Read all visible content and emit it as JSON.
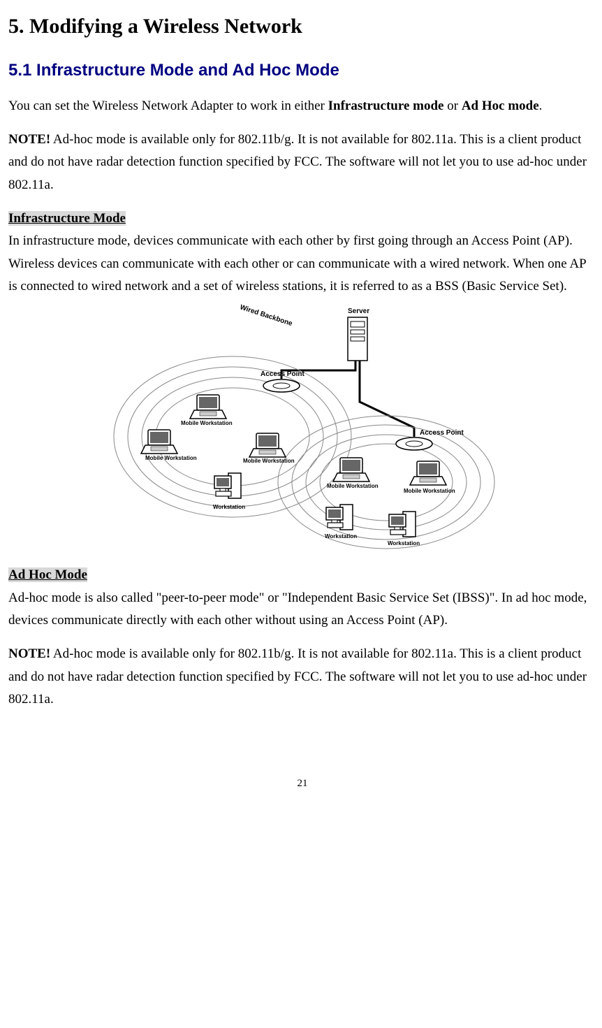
{
  "heading_main": "5. Modifying a Wireless Network",
  "heading_sub": "5.1 Infrastructure Mode and Ad Hoc Mode",
  "intro": {
    "t1": "You can set the Wireless Network Adapter to work in either ",
    "b1": "Infrastructure mode",
    "t2": " or ",
    "b2": "Ad Hoc mode",
    "t3": "."
  },
  "note1": {
    "label": "NOTE!",
    "text": " Ad-hoc mode is available only for 802.11b/g.    It is not available for 802.11a. This is a client product and do not have radar detection function specified by FCC. The software will not let you to use ad-hoc under 802.11a."
  },
  "infra": {
    "title": "Infrastructure Mode",
    "text": "In infrastructure mode, devices communicate with each other by first going through an Access Point (AP).    Wireless devices can communicate with each other or can communicate with a wired network.    When one AP is connected to wired network and a set of wireless stations, it is referred to as a BSS (Basic Service Set)."
  },
  "diagram": {
    "wired_backbone": "Wired Backbone",
    "server": "Server",
    "access_point": "Access Point",
    "mobile_workstation": "Mobile Workstation",
    "workstation": "Workstation"
  },
  "adhoc": {
    "title": "Ad Hoc Mode",
    "text": "Ad-hoc mode is also called \"peer-to-peer mode\" or \"Independent Basic Service Set (IBSS)\".    In ad hoc mode, devices communicate directly with each other without using an Access Point (AP)."
  },
  "note2": {
    "label": "NOTE!",
    "text": " Ad-hoc mode is available only for 802.11b/g.    It is not available for 802.11a. This is a client product and do not have radar detection function specified by FCC. The software will not let you to use ad-hoc under 802.11a."
  },
  "page_number": "21"
}
